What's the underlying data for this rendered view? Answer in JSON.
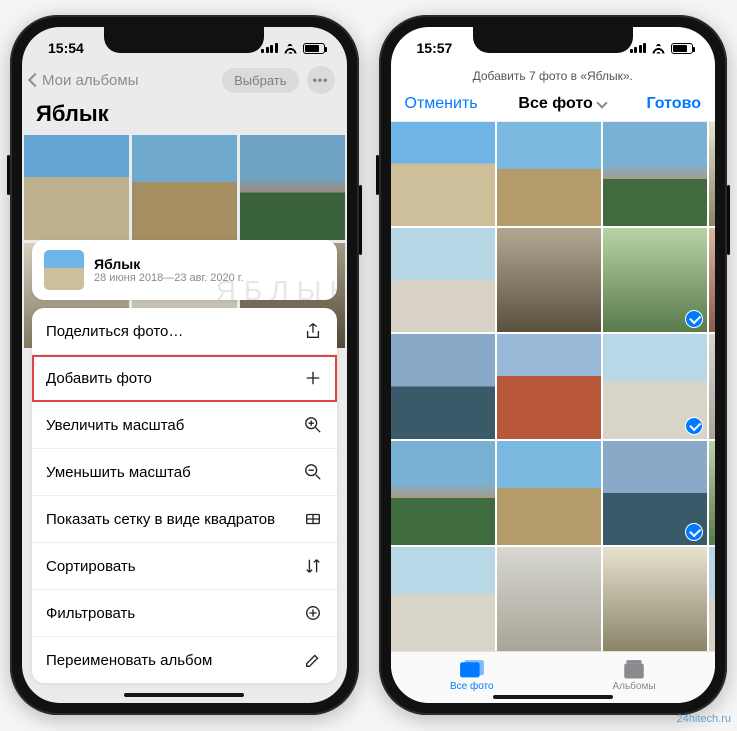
{
  "phone1": {
    "time": "15:54",
    "back_label": "Мои альбомы",
    "select_label": "Выбрать",
    "album_title": "Яблык",
    "sheet": {
      "title": "Яблык",
      "subtitle": "28 июня 2018—23 авг. 2020 г.",
      "items": [
        {
          "label": "Поделиться фото…",
          "icon": "share"
        },
        {
          "label": "Добавить фото",
          "icon": "plus",
          "highlight": true
        },
        {
          "label": "Увеличить масштаб",
          "icon": "zoom-in"
        },
        {
          "label": "Уменьшить масштаб",
          "icon": "zoom-out"
        },
        {
          "label": "Показать сетку в виде квадратов",
          "icon": "grid"
        },
        {
          "label": "Сортировать",
          "icon": "sort"
        },
        {
          "label": "Фильтровать",
          "icon": "filter"
        },
        {
          "label": "Переименовать альбом",
          "icon": "rename"
        }
      ]
    }
  },
  "phone2": {
    "time": "15:57",
    "header_text": "Добавить 7 фото в «Яблык».",
    "cancel": "Отменить",
    "title": "Все фото",
    "done": "Готово",
    "selected_indices": [
      6,
      7,
      10,
      11,
      14,
      15,
      19
    ],
    "tabs": {
      "all": "Все фото",
      "albums": "Альбомы"
    }
  },
  "watermark_center": "ЯБЛЫК",
  "watermark_corner": "24hitech.ru"
}
